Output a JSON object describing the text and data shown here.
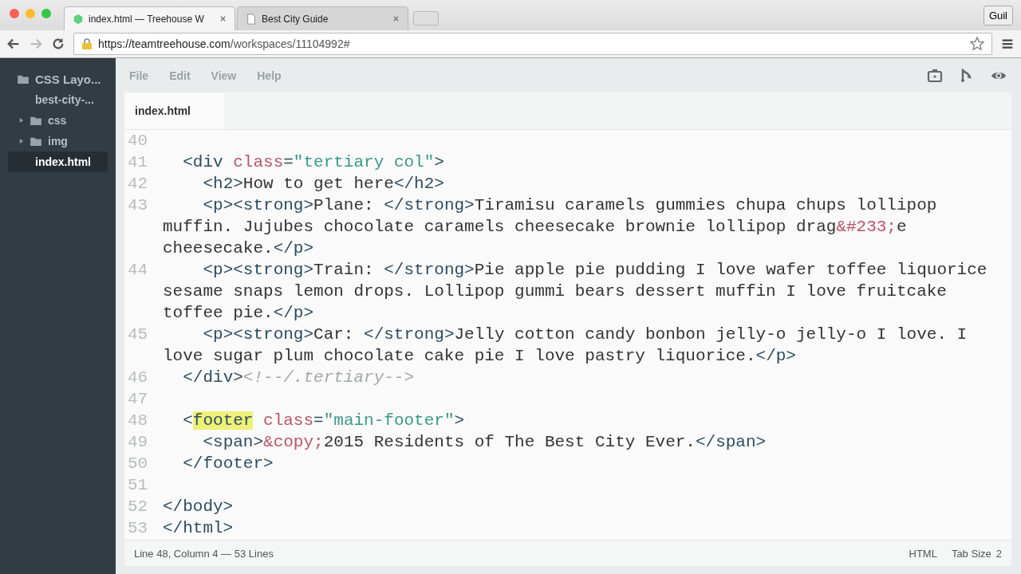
{
  "browser": {
    "tabs": [
      {
        "title": "index.html — Treehouse W",
        "selected": true
      },
      {
        "title": "Best City Guide",
        "selected": false
      }
    ],
    "profile": "Guil",
    "url": {
      "host": "https://teamtreehouse.com",
      "path": "/workspaces/11104992#"
    }
  },
  "sidebar": {
    "project": "CSS Layo...",
    "items": [
      {
        "label": "best-city-...",
        "kind": "root",
        "selected": false
      },
      {
        "label": "css",
        "kind": "folder",
        "selected": false
      },
      {
        "label": "img",
        "kind": "folder",
        "selected": false
      },
      {
        "label": "index.html",
        "kind": "file",
        "selected": true
      }
    ]
  },
  "menu": [
    "File",
    "Edit",
    "View",
    "Help"
  ],
  "editor": {
    "tab": "index.html",
    "lines": [
      {
        "number": "40",
        "rows": [
          []
        ]
      },
      {
        "number": "41",
        "rows": [
          [
            {
              "kind": "text",
              "text": "  "
            },
            {
              "kind": "tag",
              "text": "<div "
            },
            {
              "kind": "attr",
              "text": "class"
            },
            {
              "kind": "tag",
              "text": "="
            },
            {
              "kind": "string",
              "text": "\"tertiary col\""
            },
            {
              "kind": "tag",
              "text": ">"
            }
          ]
        ]
      },
      {
        "number": "42",
        "rows": [
          [
            {
              "kind": "text",
              "text": "    "
            },
            {
              "kind": "tag",
              "text": "<h2>"
            },
            {
              "kind": "text",
              "text": "How to get here"
            },
            {
              "kind": "tag",
              "text": "</h2>"
            }
          ]
        ]
      },
      {
        "number": "43",
        "rows": [
          [
            {
              "kind": "text",
              "text": "    "
            },
            {
              "kind": "tag",
              "text": "<p><strong>"
            },
            {
              "kind": "text",
              "text": "Plane: "
            },
            {
              "kind": "tag",
              "text": "</strong>"
            },
            {
              "kind": "text",
              "text": "Tiramisu caramels gummies chupa chups lollipop"
            }
          ]
        ]
      },
      {
        "rows": [
          [
            {
              "kind": "text",
              "text": "muffin. Jujubes chocolate caramels cheesecake brownie lollipop drag"
            },
            {
              "kind": "entity",
              "text": "&#233;"
            },
            {
              "kind": "text",
              "text": "e"
            }
          ]
        ]
      },
      {
        "rows": [
          [
            {
              "kind": "text",
              "text": "cheesecake."
            },
            {
              "kind": "tag",
              "text": "</p>"
            }
          ]
        ]
      },
      {
        "number": "44",
        "rows": [
          [
            {
              "kind": "text",
              "text": "    "
            },
            {
              "kind": "tag",
              "text": "<p><strong>"
            },
            {
              "kind": "text",
              "text": "Train: "
            },
            {
              "kind": "tag",
              "text": "</strong>"
            },
            {
              "kind": "text",
              "text": "Pie apple pie pudding I love wafer toffee liquorice"
            }
          ]
        ]
      },
      {
        "rows": [
          [
            {
              "kind": "text",
              "text": "sesame snaps lemon drops. Lollipop gummi bears dessert muffin I love fruitcake"
            }
          ]
        ]
      },
      {
        "rows": [
          [
            {
              "kind": "text",
              "text": "toffee pie."
            },
            {
              "kind": "tag",
              "text": "</p>"
            }
          ]
        ]
      },
      {
        "number": "45",
        "rows": [
          [
            {
              "kind": "text",
              "text": "    "
            },
            {
              "kind": "tag",
              "text": "<p><strong>"
            },
            {
              "kind": "text",
              "text": "Car: "
            },
            {
              "kind": "tag",
              "text": "</strong>"
            },
            {
              "kind": "text",
              "text": "Jelly cotton candy bonbon jelly-o jelly-o I love. I"
            }
          ]
        ]
      },
      {
        "rows": [
          [
            {
              "kind": "text",
              "text": "love sugar plum chocolate cake pie I love pastry liquorice."
            },
            {
              "kind": "tag",
              "text": "</p>"
            }
          ]
        ]
      },
      {
        "number": "46",
        "rows": [
          [
            {
              "kind": "text",
              "text": "  "
            },
            {
              "kind": "tag",
              "text": "</div>"
            },
            {
              "kind": "comment",
              "text": "<!--/.tertiary-->"
            }
          ]
        ]
      },
      {
        "number": "47",
        "rows": [
          []
        ]
      },
      {
        "number": "48",
        "rows": [
          [
            {
              "kind": "text",
              "text": "  "
            },
            {
              "kind": "tag",
              "text": "<"
            },
            {
              "kind": "match",
              "text": "footer"
            },
            {
              "kind": "tag",
              "text": " "
            },
            {
              "kind": "attr",
              "text": "class"
            },
            {
              "kind": "tag",
              "text": "="
            },
            {
              "kind": "string",
              "text": "\"main-footer\""
            },
            {
              "kind": "tag",
              "text": ">"
            }
          ]
        ]
      },
      {
        "number": "49",
        "rows": [
          [
            {
              "kind": "text",
              "text": "    "
            },
            {
              "kind": "tag",
              "text": "<span>"
            },
            {
              "kind": "entity",
              "text": "&copy;"
            },
            {
              "kind": "text",
              "text": "2015 Residents of The Best City Ever."
            },
            {
              "kind": "tag",
              "text": "</span>"
            }
          ]
        ]
      },
      {
        "number": "50",
        "rows": [
          [
            {
              "kind": "text",
              "text": "  "
            },
            {
              "kind": "tag",
              "text": "</footer>"
            }
          ]
        ]
      },
      {
        "number": "51",
        "rows": [
          []
        ]
      },
      {
        "number": "52",
        "rows": [
          [
            {
              "kind": "tag",
              "text": "</body>"
            }
          ]
        ]
      },
      {
        "number": "53",
        "rows": [
          [
            {
              "kind": "tag",
              "text": "</html>"
            }
          ]
        ]
      }
    ]
  },
  "status_bar": {
    "position": "Line 48, Column 4 — 53 Lines",
    "mode": "HTML",
    "tab_size_label": "Tab Size",
    "tab_size": "2"
  }
}
